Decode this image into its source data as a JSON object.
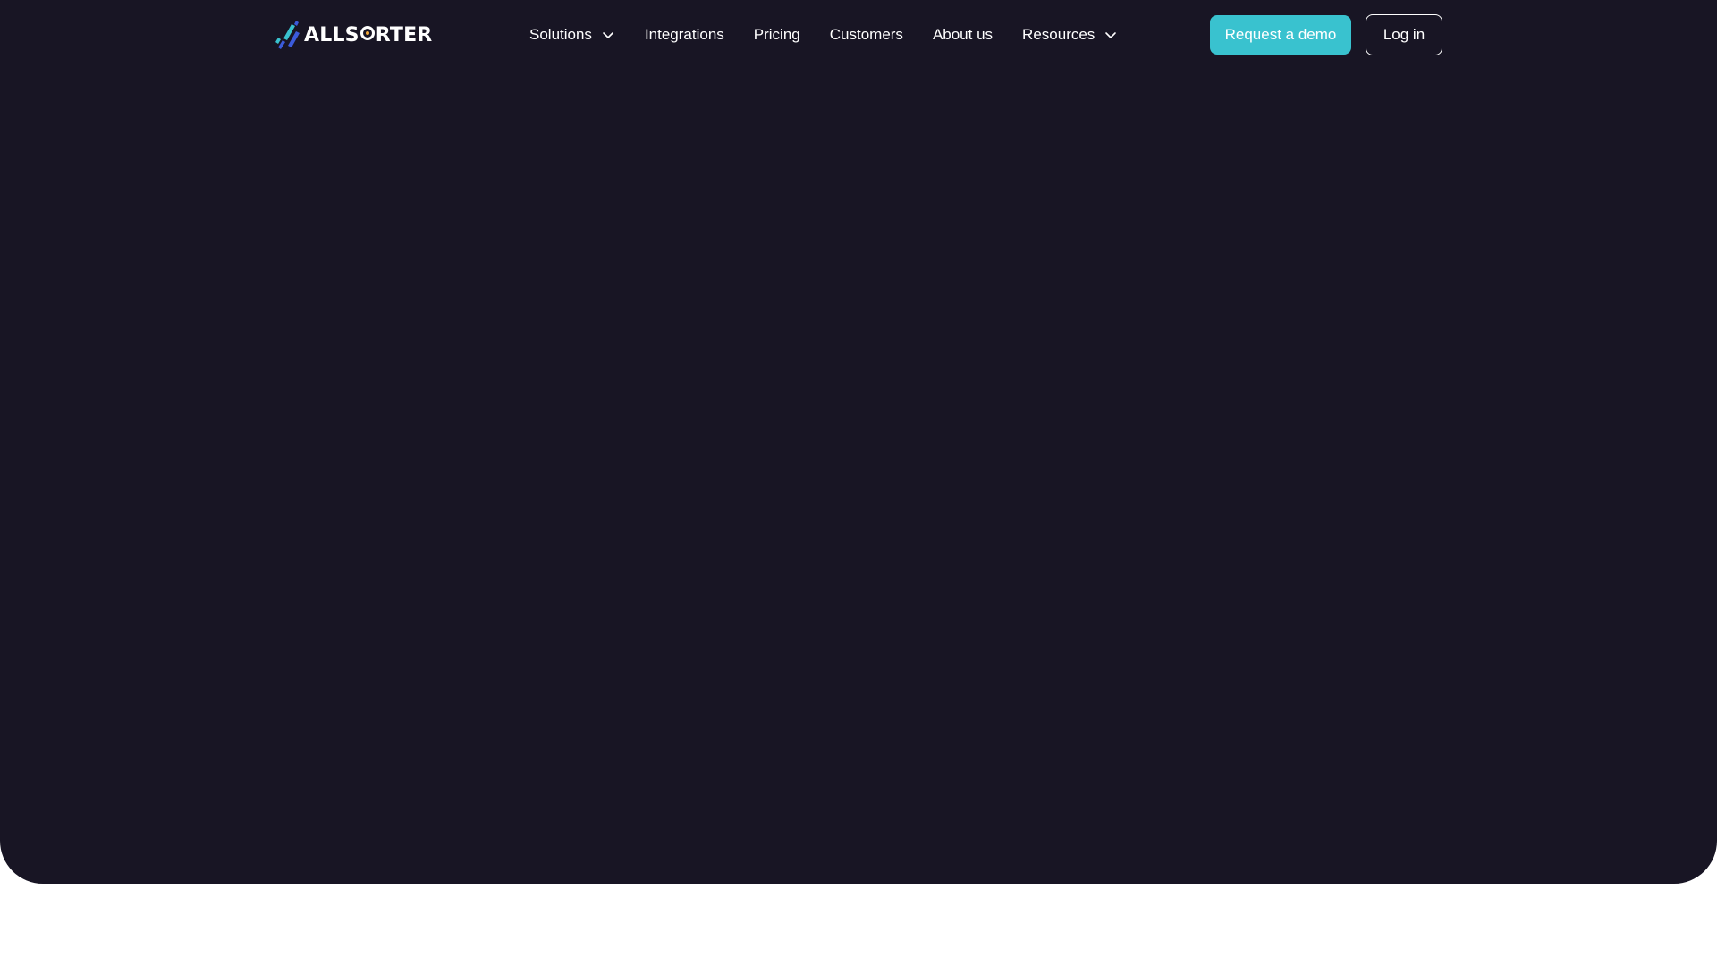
{
  "brand": {
    "name_part1": "ALLS",
    "name_part2": "RTER",
    "colors": {
      "hero_background": "#181524",
      "page_background": "#ffffff",
      "accent": "#39c2cf",
      "logo_dot": "#f2a93b",
      "logo_blue": "#3b5bdb",
      "logo_cyan": "#39c2cf"
    }
  },
  "nav": {
    "items": [
      {
        "label": "Solutions",
        "has_dropdown": true,
        "icon": "chevron-down-icon"
      },
      {
        "label": "Integrations",
        "has_dropdown": false
      },
      {
        "label": "Pricing",
        "has_dropdown": false
      },
      {
        "label": "Customers",
        "has_dropdown": false
      },
      {
        "label": "About us",
        "has_dropdown": false
      },
      {
        "label": "Resources",
        "has_dropdown": true,
        "icon": "chevron-down-icon"
      }
    ]
  },
  "actions": {
    "demo_label": "Request a demo",
    "login_label": "Log in"
  }
}
